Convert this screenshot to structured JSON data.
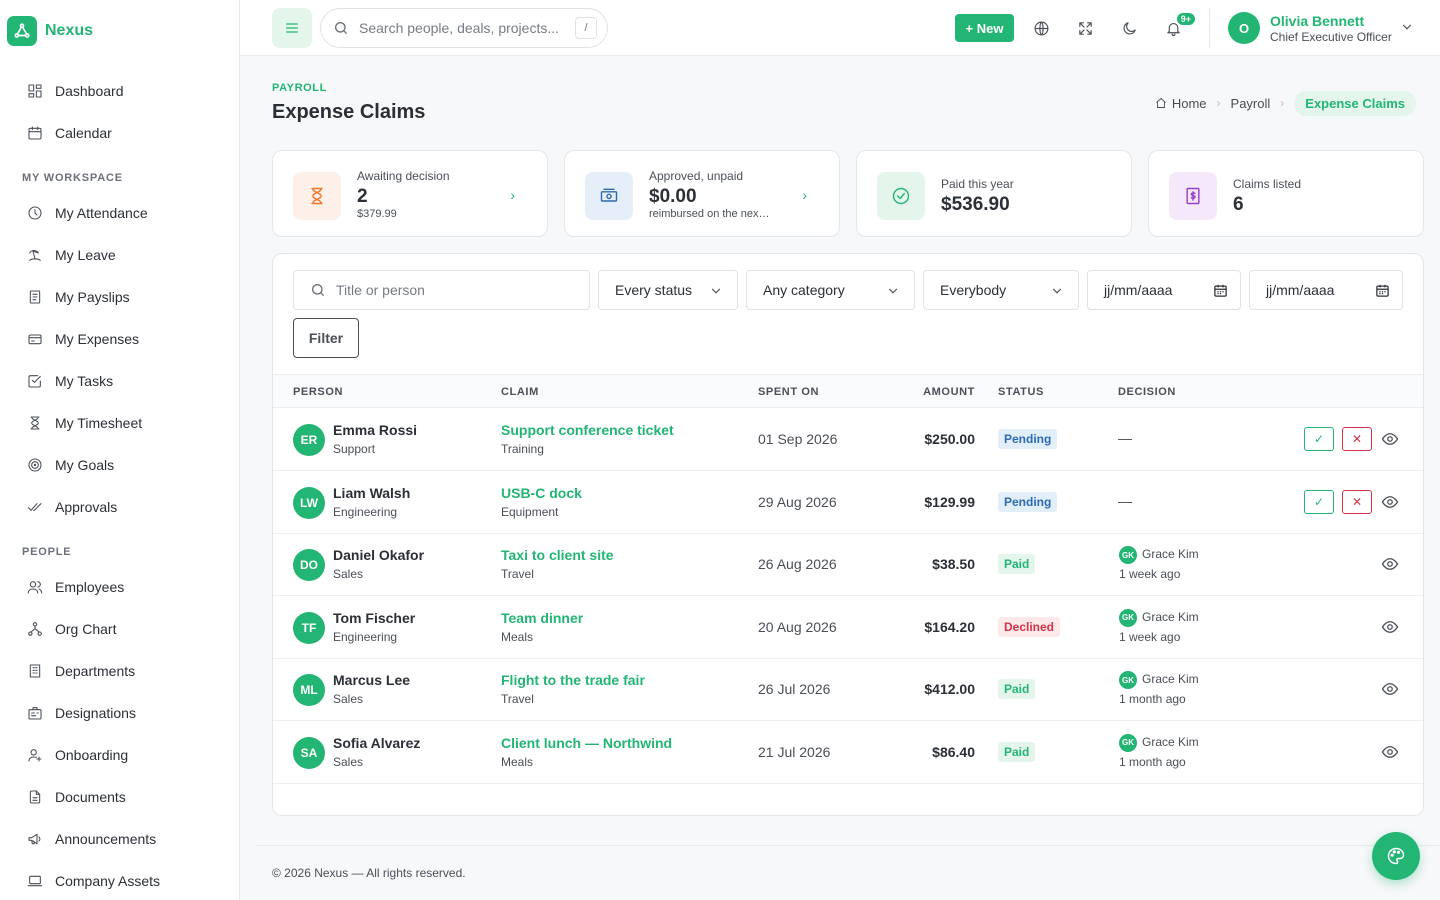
{
  "brand": {
    "name": "Nexus",
    "color": "#22b573"
  },
  "sidebar": {
    "top_items": [
      {
        "label": "Dashboard",
        "icon": "dashboard-icon"
      },
      {
        "label": "Calendar",
        "icon": "calendar-icon"
      }
    ],
    "workspace_title": "MY WORKSPACE",
    "workspace_items": [
      {
        "label": "My Attendance",
        "icon": "clock-icon"
      },
      {
        "label": "My Leave",
        "icon": "beach-icon"
      },
      {
        "label": "My Payslips",
        "icon": "payslip-icon"
      },
      {
        "label": "My Expenses",
        "icon": "card-icon"
      },
      {
        "label": "My Tasks",
        "icon": "check-square-icon"
      },
      {
        "label": "My Timesheet",
        "icon": "hourglass-icon"
      },
      {
        "label": "My Goals",
        "icon": "target-icon"
      },
      {
        "label": "Approvals",
        "icon": "double-check-icon"
      }
    ],
    "people_title": "PEOPLE",
    "people_items": [
      {
        "label": "Employees",
        "icon": "users-icon"
      },
      {
        "label": "Org Chart",
        "icon": "org-chart-icon"
      },
      {
        "label": "Departments",
        "icon": "building-icon"
      },
      {
        "label": "Designations",
        "icon": "id-badge-icon"
      },
      {
        "label": "Onboarding",
        "icon": "user-plus-icon"
      },
      {
        "label": "Documents",
        "icon": "documents-icon"
      },
      {
        "label": "Announcements",
        "icon": "megaphone-icon"
      },
      {
        "label": "Company Assets",
        "icon": "laptop-icon"
      }
    ]
  },
  "topbar": {
    "search_placeholder": "Search people, deals, projects...",
    "search_shortcut": "/",
    "new_label": "+ New",
    "notif_badge": "9+",
    "user": {
      "initial": "O",
      "name": "Olivia Bennett",
      "role": "Chief Executive Officer"
    }
  },
  "header": {
    "overline": "PAYROLL",
    "title": "Expense Claims",
    "breadcrumb": [
      "Home",
      "Payroll",
      "Expense Claims"
    ]
  },
  "stats": [
    {
      "label": "Awaiting decision",
      "value": "2",
      "sub": "$379.99",
      "icon": "hourglass-icon",
      "color": "#f0782f",
      "bg": "#fdf0e8"
    },
    {
      "label": "Approved, unpaid",
      "value": "$0.00",
      "sub": "reimbursed on the next payroll",
      "icon": "cash-icon",
      "color": "#2b6cb0",
      "bg": "#e6eefa"
    },
    {
      "label": "Paid this year",
      "value": "$536.90",
      "sub": "",
      "icon": "check-circle-icon",
      "color": "#22b573",
      "bg": "#e4f6ec"
    },
    {
      "label": "Claims listed",
      "value": "6",
      "sub": "",
      "icon": "receipt-icon",
      "color": "#9b3fc4",
      "bg": "#f4e8fa"
    }
  ],
  "filters": {
    "search_placeholder": "Title or person",
    "status": "Every status",
    "category": "Any category",
    "person": "Everybody",
    "date_from_placeholder": "jj/mm/aaaa",
    "date_to_placeholder": "jj/mm/aaaa",
    "filter_label": "Filter"
  },
  "table": {
    "columns": [
      "PERSON",
      "CLAIM",
      "SPENT ON",
      "AMOUNT",
      "STATUS",
      "DECISION"
    ],
    "rows": [
      {
        "initials": "ER",
        "name": "Emma Rossi",
        "dept": "Support",
        "title": "Support conference ticket",
        "category": "Training",
        "spent": "01 Sep 2026",
        "amount": "$250.00",
        "status": "Pending",
        "decision": "—",
        "decider_initials": "",
        "decider": "",
        "when": "",
        "actions": true
      },
      {
        "initials": "LW",
        "name": "Liam Walsh",
        "dept": "Engineering",
        "title": "USB-C dock",
        "category": "Equipment",
        "spent": "29 Aug 2026",
        "amount": "$129.99",
        "status": "Pending",
        "decision": "—",
        "decider_initials": "",
        "decider": "",
        "when": "",
        "actions": true
      },
      {
        "initials": "DO",
        "name": "Daniel Okafor",
        "dept": "Sales",
        "title": "Taxi to client site",
        "category": "Travel",
        "spent": "26 Aug 2026",
        "amount": "$38.50",
        "status": "Paid",
        "decision": "",
        "decider_initials": "GK",
        "decider": "Grace Kim",
        "when": "1 week ago",
        "actions": false
      },
      {
        "initials": "TF",
        "name": "Tom Fischer",
        "dept": "Engineering",
        "title": "Team dinner",
        "category": "Meals",
        "spent": "20 Aug 2026",
        "amount": "$164.20",
        "status": "Declined",
        "decision": "",
        "decider_initials": "GK",
        "decider": "Grace Kim",
        "when": "1 week ago",
        "actions": false
      },
      {
        "initials": "ML",
        "name": "Marcus Lee",
        "dept": "Sales",
        "title": "Flight to the trade fair",
        "category": "Travel",
        "spent": "26 Jul 2026",
        "amount": "$412.00",
        "status": "Paid",
        "decision": "",
        "decider_initials": "GK",
        "decider": "Grace Kim",
        "when": "1 month ago",
        "actions": false
      },
      {
        "initials": "SA",
        "name": "Sofia Alvarez",
        "dept": "Sales",
        "title": "Client lunch — Northwind",
        "category": "Meals",
        "spent": "21 Jul 2026",
        "amount": "$86.40",
        "status": "Paid",
        "decision": "",
        "decider_initials": "GK",
        "decider": "Grace Kim",
        "when": "1 month ago",
        "actions": false
      }
    ],
    "approve_glyph": "✓",
    "reject_glyph": "✕"
  },
  "footer": {
    "text": "© 2026 Nexus — All rights reserved."
  }
}
